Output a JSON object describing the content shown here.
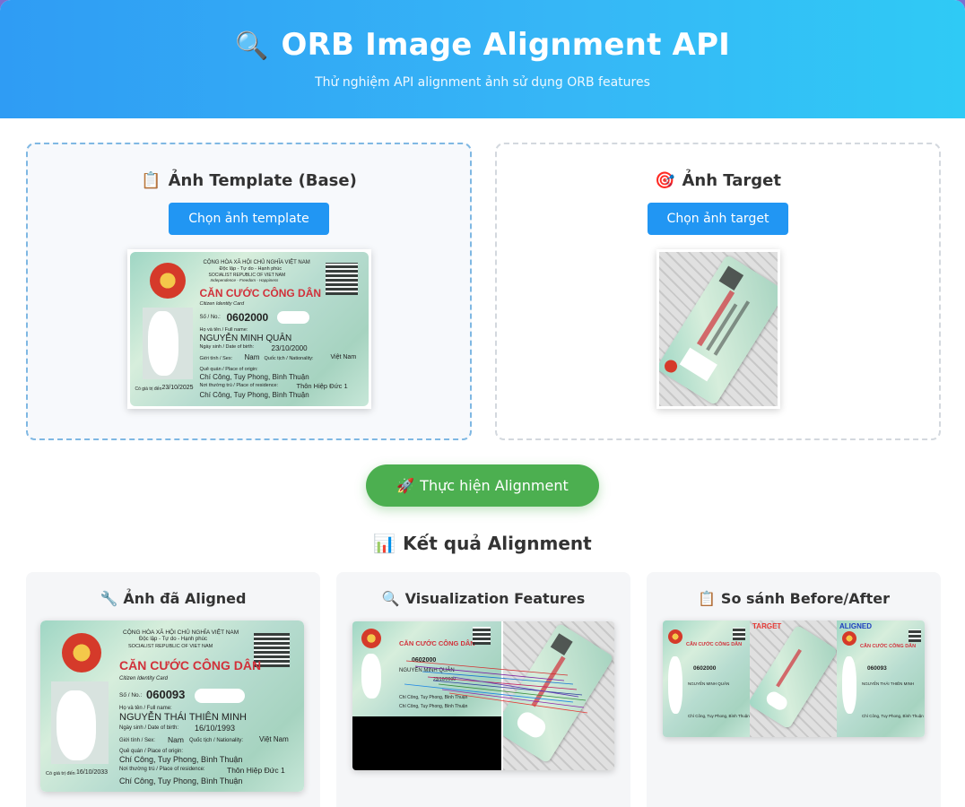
{
  "header": {
    "icon": "magnifier-icon",
    "title_emoji": "🔍",
    "title": "ORB Image Alignment API",
    "subtitle": "Thử nghiệm API alignment ảnh sử dụng ORB features"
  },
  "upload": {
    "template": {
      "emoji": "📋",
      "title": "Ảnh Template (Base)",
      "button": "Chọn ảnh template"
    },
    "target": {
      "emoji": "🎯",
      "title": "Ảnh Target",
      "button": "Chọn ảnh target"
    }
  },
  "card_text": {
    "nation": "CỘNG HÒA XÃ HỘI CHỦ NGHĨA VIỆT NAM",
    "motto": "Độc lập - Tự do - Hạnh phúc",
    "nation_en": "SOCIALIST REPUBLIC OF VIET NAM",
    "motto_en": "Independence - Freedom - Happiness",
    "card_title": "CĂN CƯỚC CÔNG DÂN",
    "card_title_en": "Citizen Identity Card",
    "number_label": "Số / No.:",
    "number_template": "0602000",
    "number_aligned": "060093",
    "name_label": "Họ và tên / Full name:",
    "name_template": "NGUYỄN MINH QUÂN",
    "name_aligned": "NGUYỄN THÁI THIÊN MINH",
    "dob_label": "Ngày sinh / Date of birth:",
    "dob_template": "23/10/2000",
    "dob_aligned": "16/10/1993",
    "sex_label": "Giới tính / Sex:",
    "sex": "Nam",
    "nationality_label": "Quốc tịch / Nationality:",
    "nationality": "Việt Nam",
    "origin_label": "Quê quán / Place of origin:",
    "origin": "Chí Công, Tuy Phong, Bình Thuận",
    "residence_label": "Nơi thường trú / Place of residence:",
    "residence_line1": "Thôn Hiệp Đức 1",
    "residence_line2": "Chí Công, Tuy Phong, Bình Thuận",
    "expiry_label": "Có giá trị đến",
    "expiry_template": "23/10/2025",
    "expiry_aligned": "16/10/2033"
  },
  "action": {
    "emoji": "🚀",
    "label": "Thực hiện Alignment"
  },
  "results": {
    "emoji": "📊",
    "title": "Kết quả Alignment",
    "cards": [
      {
        "emoji": "🔧",
        "title": "Ảnh đã Aligned"
      },
      {
        "emoji": "🔍",
        "title": "Visualization Features"
      },
      {
        "emoji": "📋",
        "title": "So sánh Before/After"
      }
    ],
    "compare_labels": {
      "target": "TARGET",
      "aligned": "ALIGNED"
    }
  },
  "colors": {
    "header_gradient_start": "#2f9cf4",
    "header_gradient_end": "#2fcaf5",
    "primary_button": "#2196f3",
    "action_button": "#4caf50"
  }
}
